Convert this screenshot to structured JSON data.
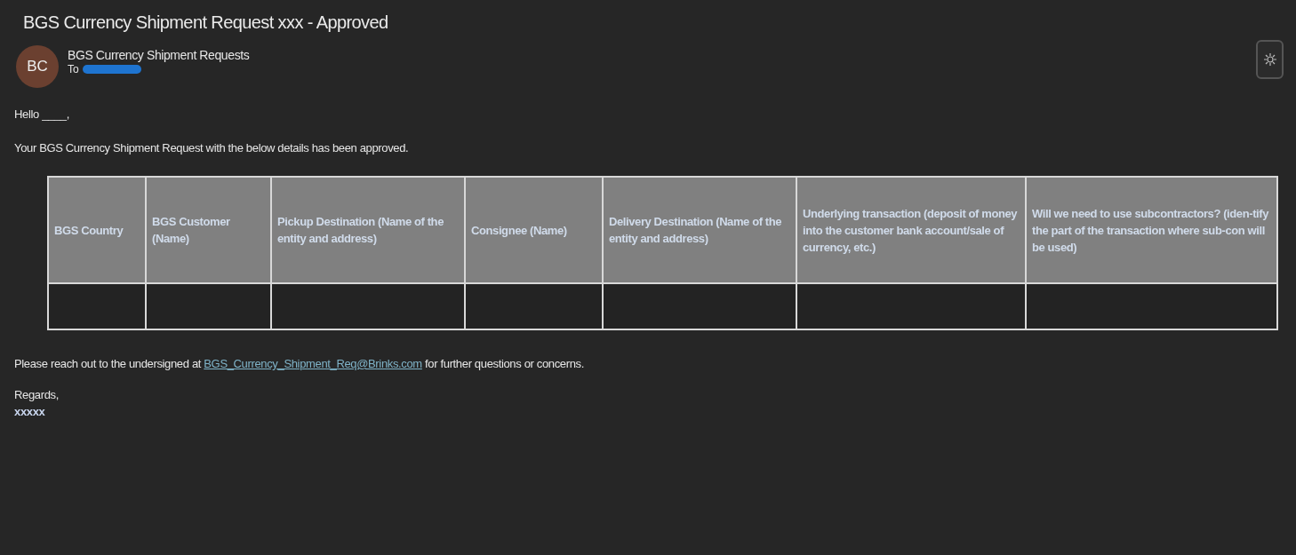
{
  "email": {
    "subject": "BGS Currency Shipment Request xxx - Approved",
    "sender": {
      "initials": "BC",
      "name": "BGS Currency Shipment Requests",
      "to_label": "To",
      "recipient_redacted": true
    },
    "greeting": "Hello ____,",
    "intro": "Your BGS Currency Shipment Request with the below details has been approved.",
    "table": {
      "columns": [
        "BGS Country",
        "BGS Customer (Name)",
        "Pickup Destination (Name of the entity and address)",
        "Consignee (Name)",
        "Delivery Destination (Name of the entity and address)",
        "Underlying transaction (deposit of money into the customer bank account/sale of currency, etc.)",
        "Will we need to use subcontractors? (iden-tify the part of the transaction where sub-con will be used)"
      ]
    },
    "contact": {
      "before": "Please reach out to the undersigned at ",
      "link": "BGS_Currency_Shipment_Req@Brinks.com",
      "after": " for further questions or concerns."
    },
    "closing": "Regards,",
    "signature": "xxxxx"
  }
}
